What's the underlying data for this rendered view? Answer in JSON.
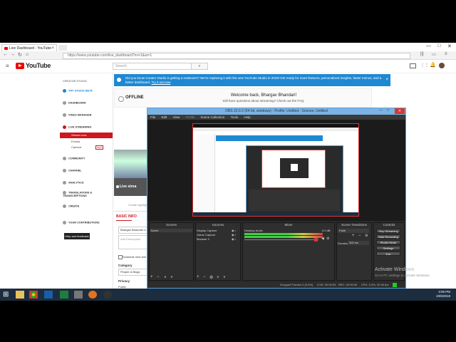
{
  "browser": {
    "tab_title": "Live Dashboard - YouTube",
    "url": "https://www.youtube.com/live_dashboard?nv=1&ar=1",
    "win_min": "—",
    "win_max": "□",
    "win_close": "✕"
  },
  "youtube": {
    "logo_text": "YouTube",
    "search_placeholder": "Search",
    "sidebar_title": "CREATOR STUDIO",
    "sidebar": [
      {
        "label": "TRY STUDIO BETA"
      },
      {
        "label": "DASHBOARD"
      },
      {
        "label": "VIDEO MANAGER"
      },
      {
        "label": "LIVE STREAMING"
      },
      {
        "label": "COMMUNITY"
      },
      {
        "label": "CHANNEL"
      },
      {
        "label": "ANALYTICS"
      },
      {
        "label": "TRANSLATIONS & TRANSCRIPTIONS"
      },
      {
        "label": "CREATE"
      },
      {
        "label": "YOUR CONTRIBUTIONS"
      }
    ],
    "live_sub": [
      "Stream now",
      "Events",
      "Camera"
    ],
    "new_badge": "NEW",
    "help_btn": "Help and feedback",
    "banner": "Did you know Creator Studio is getting a makeover? We're replacing it with the new YouTube Studio in 2019! Get ready for more features, personalized insights, faster menus, and a better dashboard.",
    "banner_link": "Try it out now",
    "offline": "OFFLINE",
    "welcome": "Welcome back, Bhargav Bhandari!",
    "welcome_sub": "Still have questions about streaming? Check out the FAQ.",
    "live_stream": "Live strea",
    "create_highlight": "Create highlight",
    "basic_info": "BASIC INFO",
    "stream_title": "Bhargav Bhandari Li",
    "add_description": "Add Description",
    "schedule": "Schedule next stre",
    "category_label": "Category",
    "category_value": "People & Blogs",
    "privacy_label": "Privacy",
    "privacy_value": "Public"
  },
  "obs": {
    "title": "OBS 22.0.2 (64 bit, windows) - Profile: Untitled - Scenes: Untitled",
    "menu": [
      "File",
      "Edit",
      "View",
      "Profile",
      "Scene Collection",
      "Tools",
      "Help"
    ],
    "panels": {
      "scenes": "Scenes",
      "sources": "Sources",
      "mixer": "Mixer",
      "transitions": "Scene Transitions",
      "controls": "Controls"
    },
    "scene_items": [
      "Scene"
    ],
    "source_items": [
      "Display Capture",
      "Game Capture",
      "Browser 2"
    ],
    "mixer_label": "Desktop Audio",
    "mixer_db": "0.0 dB",
    "transition": "Fade",
    "duration_label": "Duration",
    "duration_value": "300 ms",
    "controls": [
      "Stop Streaming",
      "Start Recording",
      "Studio Mode",
      "Settings",
      "Exit"
    ],
    "status": {
      "dropped": "Dropped Frames 0 (0.0%)",
      "live": "LIVE: 00:00:53",
      "rec": "REC: 00:00:00",
      "cpu": "CPU: 3.4%, 30.00 fps"
    }
  },
  "windows": {
    "activate_title": "Activate Windows",
    "activate_sub": "Go to PC settings to activate Windows.",
    "time": "3:05 PM",
    "date": "10/6/2018"
  }
}
